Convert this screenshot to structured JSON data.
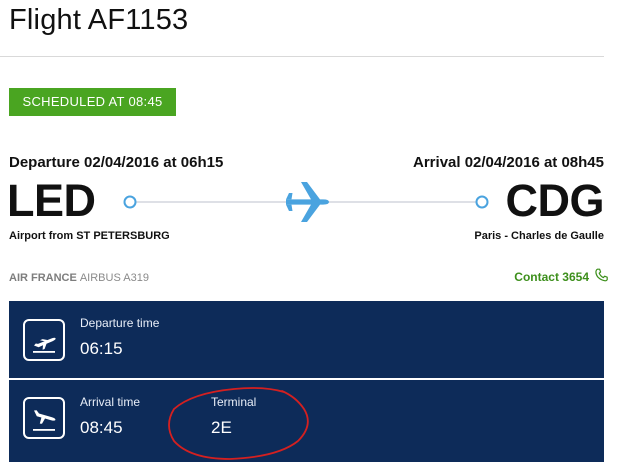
{
  "flight": {
    "title": "Flight AF1153",
    "status": "SCHEDULED AT 08:45"
  },
  "departure": {
    "line": "Departure 02/04/2016 at 06h15",
    "code": "LED",
    "airport": "Airport from ST PETERSBURG"
  },
  "arrival": {
    "line": "Arrival 02/04/2016 at 08h45",
    "code": "CDG",
    "airport": "Paris - Charles de Gaulle"
  },
  "carrier": {
    "name": "AIR FRANCE",
    "aircraft": "AIRBUS A319"
  },
  "contact": {
    "label": "Contact 3654",
    "icon": "phone-icon"
  },
  "panels": {
    "departure_time": {
      "label": "Departure time",
      "value": "06:15",
      "icon": "plane-takeoff-icon"
    },
    "arrival_time": {
      "label": "Arrival time",
      "value": "08:45",
      "icon": "plane-landing-icon"
    },
    "terminal": {
      "label": "Terminal",
      "value": "2E"
    }
  },
  "colors": {
    "status_green": "#4aa521",
    "contact_green": "#3d8f1c",
    "panel_navy": "#0d2b59",
    "route_blue": "#4aa3df",
    "annotation_red": "#d42020"
  }
}
